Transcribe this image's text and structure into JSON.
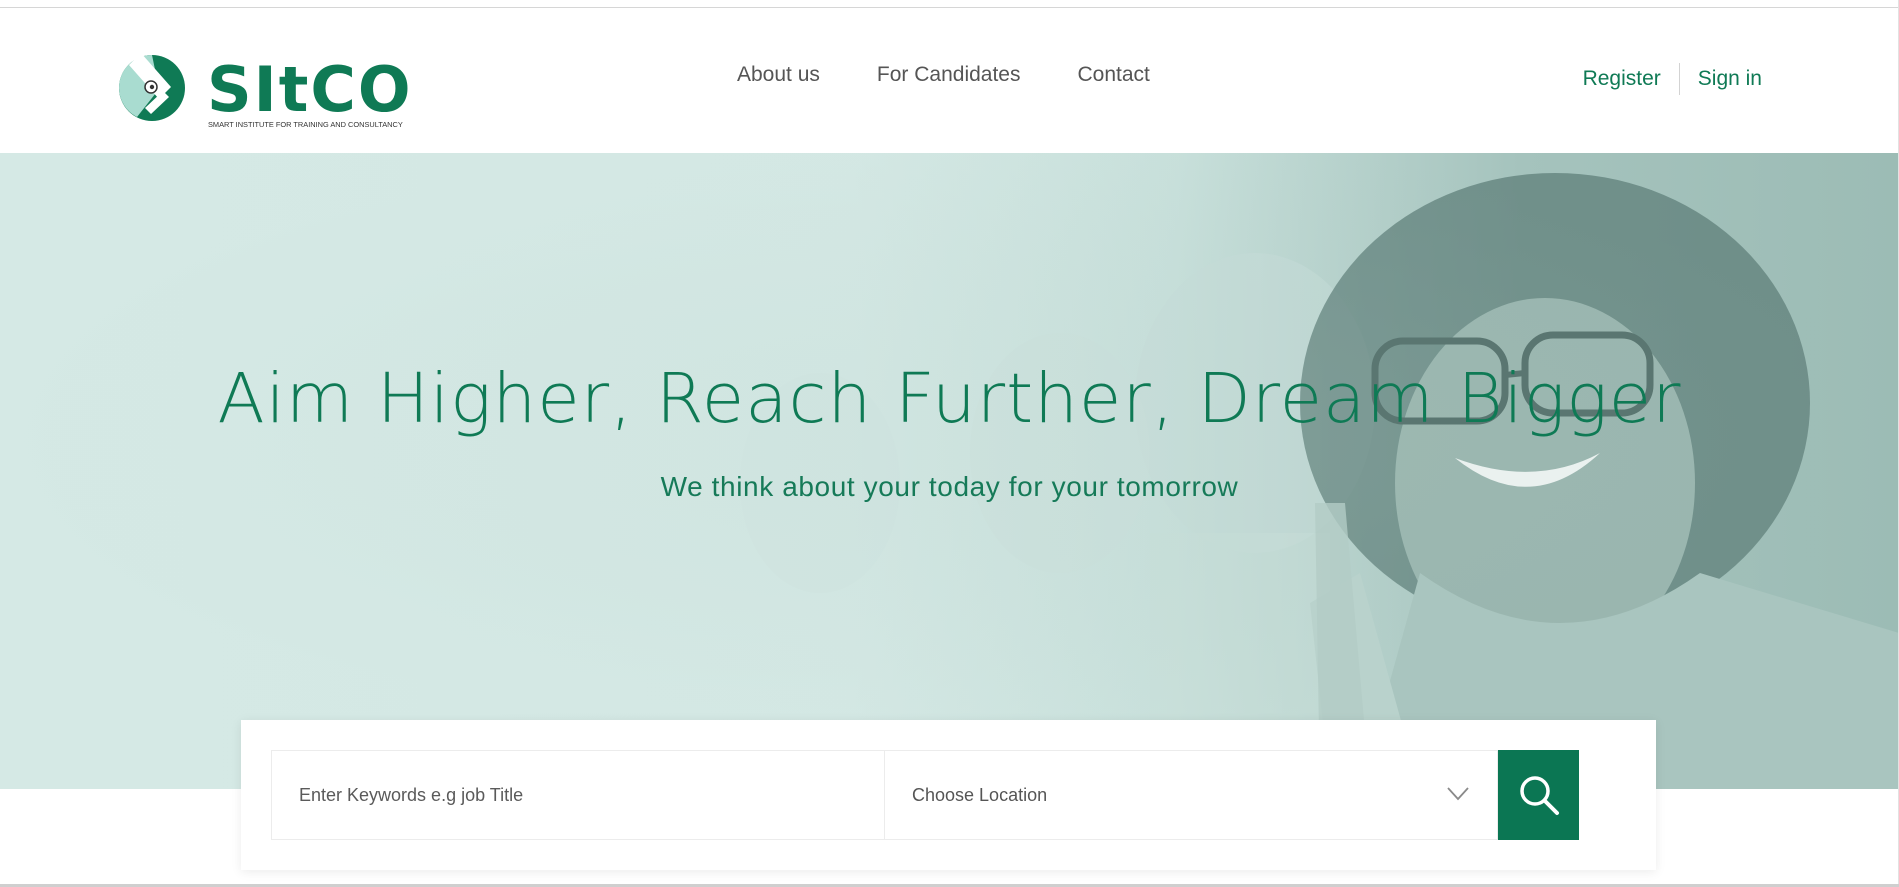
{
  "brand": {
    "logo_text": "SItCO",
    "tagline": "SMART INSTITUTE FOR TRAINING AND CONSULTANCY",
    "primary_color": "#0f7a55",
    "accent_light": "#a9dcd0"
  },
  "nav": {
    "items": [
      {
        "label": "About us"
      },
      {
        "label": "For Candidates"
      },
      {
        "label": "Contact"
      }
    ]
  },
  "auth": {
    "register_label": "Register",
    "signin_label": "Sign in"
  },
  "hero": {
    "title": "Aim Higher, Reach Further, Dream Bigger",
    "subtitle": "We think about your today for your tomorrow"
  },
  "search": {
    "keyword_placeholder": "Enter Keywords e.g job Title",
    "location_value": "Choose Location",
    "location_icon": "chevron-down-icon",
    "search_icon": "search-icon"
  }
}
